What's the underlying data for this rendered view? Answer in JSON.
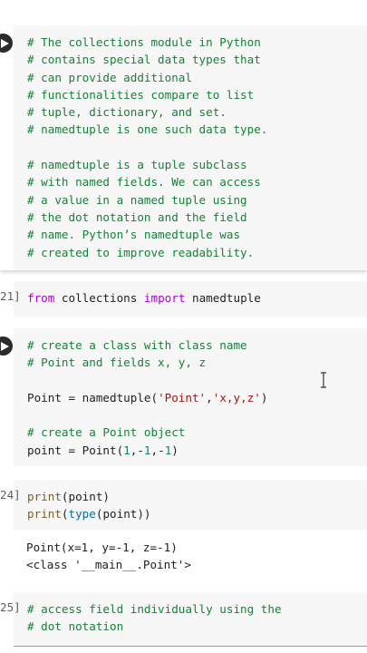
{
  "cells": [
    {
      "id": "cell-1",
      "comment_lines": [
        "# The collections module in Python",
        "# contains special data types that",
        "# can provide additional",
        "# functionalities compare to list",
        "# tuple, dictionary, and set.",
        "# namedtuple is one such data type.",
        "",
        "# namedtuple is a tuple subclass",
        "# with named fields. We can access",
        "# a value in a named tuple using",
        "# the dot notation and the field",
        "# name. Python’s namedtuple was",
        "# created to improve readability."
      ]
    },
    {
      "id": "cell-2",
      "exec_count": "21]",
      "tokens": {
        "from": "from",
        "module": " collections ",
        "import": "import",
        "name": " namedtuple"
      }
    },
    {
      "id": "cell-3",
      "comment_1": "# create a class with class name",
      "comment_2": "# Point and fields x, y, z",
      "line_point": {
        "lhs": "Point = namedtuple(",
        "str": "'Point'",
        "comma": ",",
        "str2": "'x,y,z'",
        "close": ")"
      },
      "comment_3": "# create a Point object",
      "line_obj": {
        "lhs": "point = Point(",
        "n1": "1",
        "c1": ",-",
        "n2": "1",
        "c2": ",-",
        "n3": "1",
        "close": ")"
      }
    },
    {
      "id": "cell-4",
      "exec_count": "24]",
      "line1": {
        "fn": "print",
        "rest": "(point)"
      },
      "line2": {
        "fn": "print",
        "open": "(",
        "ty": "type",
        "rest": "(point))"
      },
      "output_lines": [
        "Point(x=1, y=-1, z=-1)",
        "<class '__main__.Point'>"
      ]
    },
    {
      "id": "cell-5",
      "exec_count": "25]",
      "comment_1": "# access field individually using the",
      "comment_2": "# dot notation"
    }
  ],
  "colors": {
    "comment": "#188038",
    "keyword": "#af00db",
    "builtin": "#795e26",
    "string": "#a31515",
    "number": "#098658",
    "cell_bg": "#f7f7f7"
  },
  "icons": {
    "run": "play-circle-icon",
    "cursor": "text-cursor-icon"
  }
}
